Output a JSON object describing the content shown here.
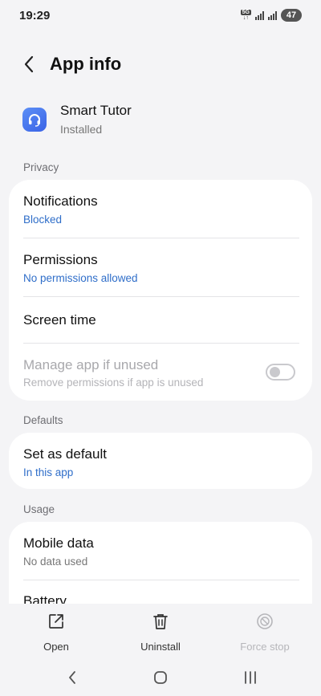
{
  "status_bar": {
    "time": "19:29",
    "network_top": "5G",
    "network_bottom": "↓↑",
    "battery": "47"
  },
  "header": {
    "title": "App info"
  },
  "app": {
    "name": "Smart Tutor",
    "status": "Installed",
    "icon": "headset-icon",
    "accent": "#4a78f0"
  },
  "privacy": {
    "label": "Privacy",
    "notifications": {
      "title": "Notifications",
      "sub": "Blocked"
    },
    "permissions": {
      "title": "Permissions",
      "sub": "No permissions allowed"
    },
    "screen_time": {
      "title": "Screen time"
    },
    "manage_unused": {
      "title": "Manage app if unused",
      "sub": "Remove permissions if app is unused",
      "enabled": false
    }
  },
  "defaults": {
    "label": "Defaults",
    "set_default": {
      "title": "Set as default",
      "sub": "In this app"
    }
  },
  "usage": {
    "label": "Usage",
    "mobile_data": {
      "title": "Mobile data",
      "sub": "No data used"
    },
    "battery": {
      "title": "Battery"
    }
  },
  "actions": {
    "open": "Open",
    "uninstall": "Uninstall",
    "force_stop": "Force stop"
  },
  "colors": {
    "link": "#2f6ec9",
    "background": "#f4f4f6",
    "card": "#ffffff"
  }
}
